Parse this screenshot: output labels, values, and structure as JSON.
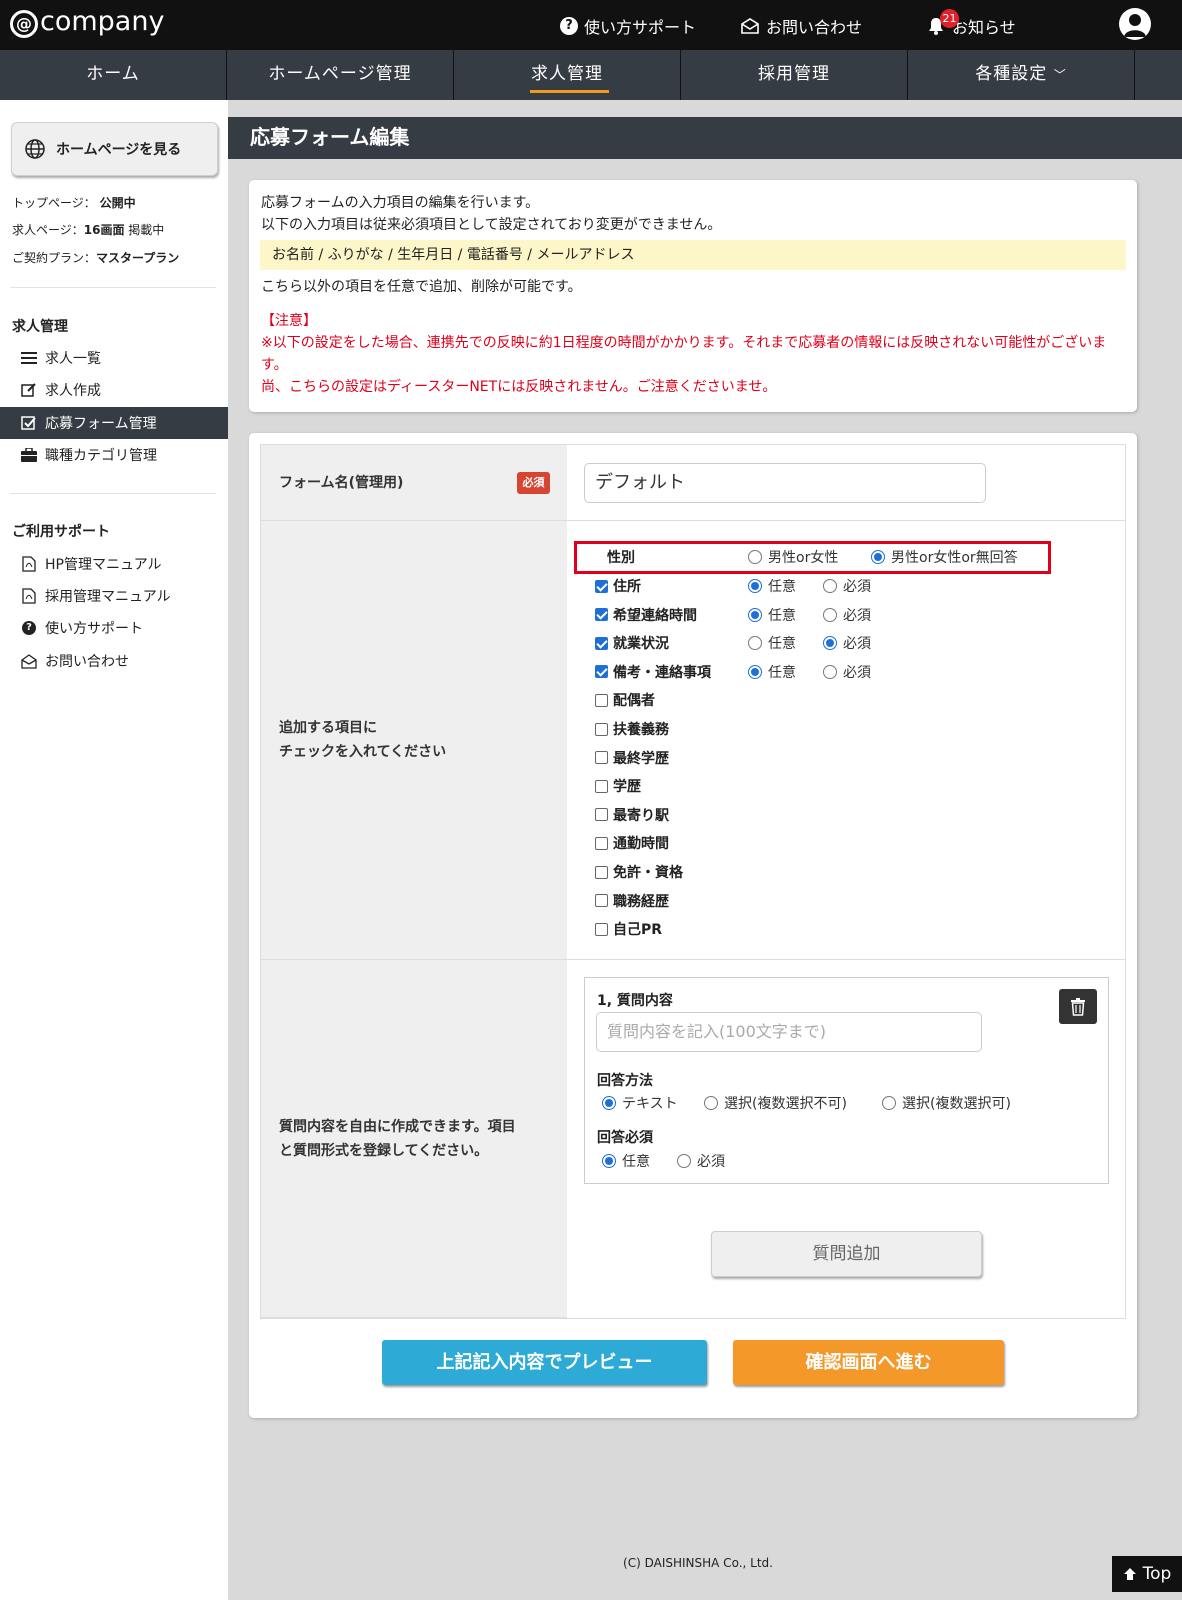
{
  "header": {
    "logo": "company",
    "help_label": "使い方サポート",
    "contact_label": "お問い合わせ",
    "notice_label": "お知らせ",
    "notice_count": "21"
  },
  "nav": {
    "items": [
      {
        "label": "ホーム"
      },
      {
        "label": "ホームページ管理"
      },
      {
        "label": "求人管理"
      },
      {
        "label": "採用管理"
      },
      {
        "label": "各種設定"
      }
    ]
  },
  "sidebar": {
    "view_button": "ホームページを見る",
    "meta": {
      "top_label": "トップページ：",
      "top_value": "公開中",
      "job_label": "求人ページ：",
      "job_count": "16画面",
      "job_suffix": "掲載中",
      "plan_label": "ご契約プラン：",
      "plan_value": "マスタープラン"
    },
    "section1_title": "求人管理",
    "section1_items": [
      {
        "label": "求人一覧"
      },
      {
        "label": "求人作成"
      },
      {
        "label": "応募フォーム管理"
      },
      {
        "label": "職種カテゴリ管理"
      }
    ],
    "section2_title": "ご利用サポート",
    "section2_items": [
      {
        "label": "HP管理マニュアル"
      },
      {
        "label": "採用管理マニュアル"
      },
      {
        "label": "使い方サポート"
      },
      {
        "label": "お問い合わせ"
      }
    ]
  },
  "page": {
    "title": "応募フォーム編集"
  },
  "notice": {
    "line1": "応募フォームの入力項目の編集を行います。",
    "line2": "以下の入力項目は従来必須項目として設定されており変更ができません。",
    "required_list": "お名前 / ふりがな / 生年月日 / 電話番号 / メールアドレス",
    "line3": "こちら以外の項目を任意で追加、削除が可能です。",
    "caution_head": "【注意】",
    "caution1": "※以下の設定をした場合、連携先での反映に約1日程度の時間がかかります。それまで応募者の情報には反映されない可能性がございます。",
    "caution2": "尚、こちらの設定はディースターNETには反映されません。ご注意くださいませ。"
  },
  "form": {
    "name_label": "フォーム名(管理用)",
    "required_badge": "必須",
    "name_value": "デフォルト",
    "fields_label_line1": "追加する項目に",
    "fields_label_line2": "チェックを入れてください",
    "gender": {
      "label": "性別",
      "option1": "男性or女性",
      "option2": "男性or女性or無回答"
    },
    "optional_label": "任意",
    "required_label": "必須",
    "fields": [
      {
        "label": "住所",
        "checked": true,
        "mode": "optional"
      },
      {
        "label": "希望連絡時間",
        "checked": true,
        "mode": "optional"
      },
      {
        "label": "就業状況",
        "checked": true,
        "mode": "required"
      },
      {
        "label": "備考・連絡事項",
        "checked": true,
        "mode": "optional"
      },
      {
        "label": "配偶者",
        "checked": false
      },
      {
        "label": "扶養義務",
        "checked": false
      },
      {
        "label": "最終学歴",
        "checked": false
      },
      {
        "label": "学歴",
        "checked": false
      },
      {
        "label": "最寄り駅",
        "checked": false
      },
      {
        "label": "通勤時間",
        "checked": false
      },
      {
        "label": "免許・資格",
        "checked": false
      },
      {
        "label": "職務経歴",
        "checked": false
      },
      {
        "label": "自己PR",
        "checked": false
      }
    ],
    "question_label_line1": "質問内容を自由に作成できます。項目",
    "question_label_line2": "と質問形式を登録してください。",
    "question": {
      "title": "1, 質問内容",
      "placeholder": "質問内容を記入(100文字まで)",
      "answer_method_label": "回答方法",
      "method_options": [
        "テキスト",
        "選択(複数選択不可)",
        "選択(複数選択可)"
      ],
      "answer_required_label": "回答必須",
      "required_options": [
        "任意",
        "必須"
      ]
    },
    "add_question": "質問追加",
    "preview_button": "上記記入内容でプレビュー",
    "confirm_button": "確認画面へ進む"
  },
  "footer": {
    "copyright": "(C) DAISHINSHA Co., Ltd.",
    "top_label": "Top"
  }
}
